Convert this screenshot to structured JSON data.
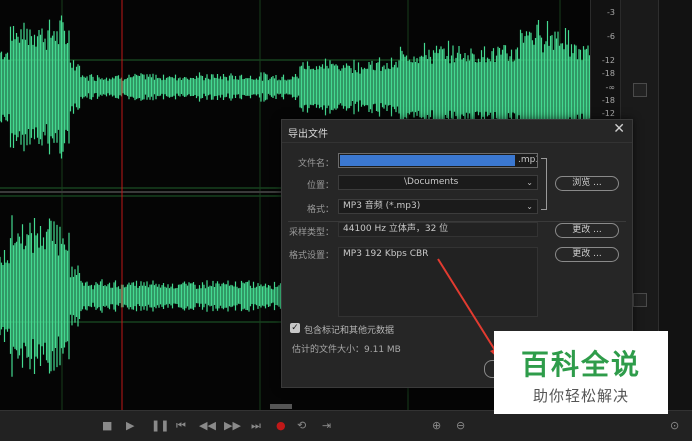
{
  "colors": {
    "waveform": "#44d990",
    "background": "#050505",
    "grid": "#1f5f2a",
    "playhead": "#c01818",
    "dialog_bg": "#262626",
    "watermark_green": "#2e9c4a"
  },
  "ruler": {
    "ticks": [
      "-3",
      "-6",
      "-12",
      "-18",
      "-∞",
      "-18",
      "-12",
      "-9",
      "-6",
      "-3"
    ]
  },
  "dialog": {
    "title": "导出文件",
    "close": "✕",
    "filename": {
      "label": "文件名：",
      "value": ".mp3"
    },
    "location": {
      "label": "位置：",
      "value": "\\Documents"
    },
    "format": {
      "label": "格式：",
      "value": "MP3 音频 (*.mp3)"
    },
    "browse_label": "浏览 ...",
    "sample_type": {
      "label": "采样类型：",
      "value": "44100 Hz 立体声，32 位"
    },
    "format_settings": {
      "label": "格式设置：",
      "value": "MP3 192 Kbps CBR"
    },
    "change_label": "更改 ...",
    "include_markers": {
      "label": "包含标记和其他元数据",
      "checked": true
    },
    "estimated_size": "估计的文件大小：9.11 MB"
  },
  "watermark": {
    "title": "百科全说",
    "subtitle": "助你轻松解决"
  },
  "icons": [
    "stop-icon",
    "play-icon",
    "pause-icon",
    "skip-back-icon",
    "rewind-icon",
    "fast-forward-icon",
    "skip-forward-icon",
    "record-icon",
    "loop-icon",
    "output-icon",
    "zoom-icons",
    "checkbox-icon",
    "dropdown-chevron-icon",
    "close-icon"
  ]
}
